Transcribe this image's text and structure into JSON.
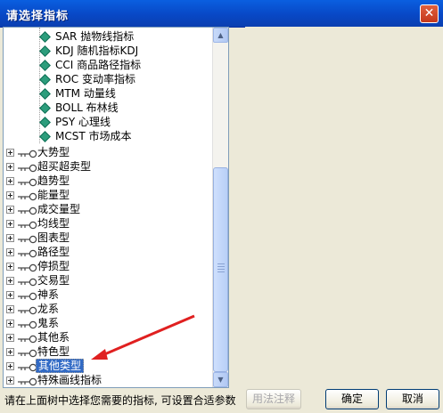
{
  "window": {
    "title": "请选择指标",
    "close_glyph": "✕"
  },
  "tree": {
    "leaf_items": [
      {
        "label": "SAR 抛物线指标"
      },
      {
        "label": "KDJ 随机指标KDJ"
      },
      {
        "label": "CCI 商品路径指标"
      },
      {
        "label": "ROC 变动率指标"
      },
      {
        "label": "MTM 动量线"
      },
      {
        "label": "BOLL 布林线"
      },
      {
        "label": "PSY 心理线"
      },
      {
        "label": "MCST 市场成本"
      }
    ],
    "categories": [
      {
        "label": "大势型"
      },
      {
        "label": "超买超卖型"
      },
      {
        "label": "趋势型"
      },
      {
        "label": "能量型"
      },
      {
        "label": "成交量型"
      },
      {
        "label": "均线型"
      },
      {
        "label": "图表型"
      },
      {
        "label": "路径型"
      },
      {
        "label": "停损型"
      },
      {
        "label": "交易型"
      },
      {
        "label": "神系"
      },
      {
        "label": "龙系"
      },
      {
        "label": "鬼系"
      },
      {
        "label": "其他系"
      },
      {
        "label": "特色型"
      },
      {
        "label": "其他类型",
        "selected": true
      },
      {
        "label": "特殊画线指标"
      }
    ]
  },
  "status_text": "请在上面树中选择您需要的指标, 可设置合适参数",
  "buttons": {
    "usage": "用法注释",
    "ok": "确定",
    "cancel": "取消"
  },
  "colors": {
    "title_bar": "#0848c6",
    "selection": "#316ac5",
    "arrow": "#e02020"
  },
  "icons": {
    "leaf": "diamond-icon",
    "category": "key-icon",
    "expand": "plus-expander-icon"
  }
}
